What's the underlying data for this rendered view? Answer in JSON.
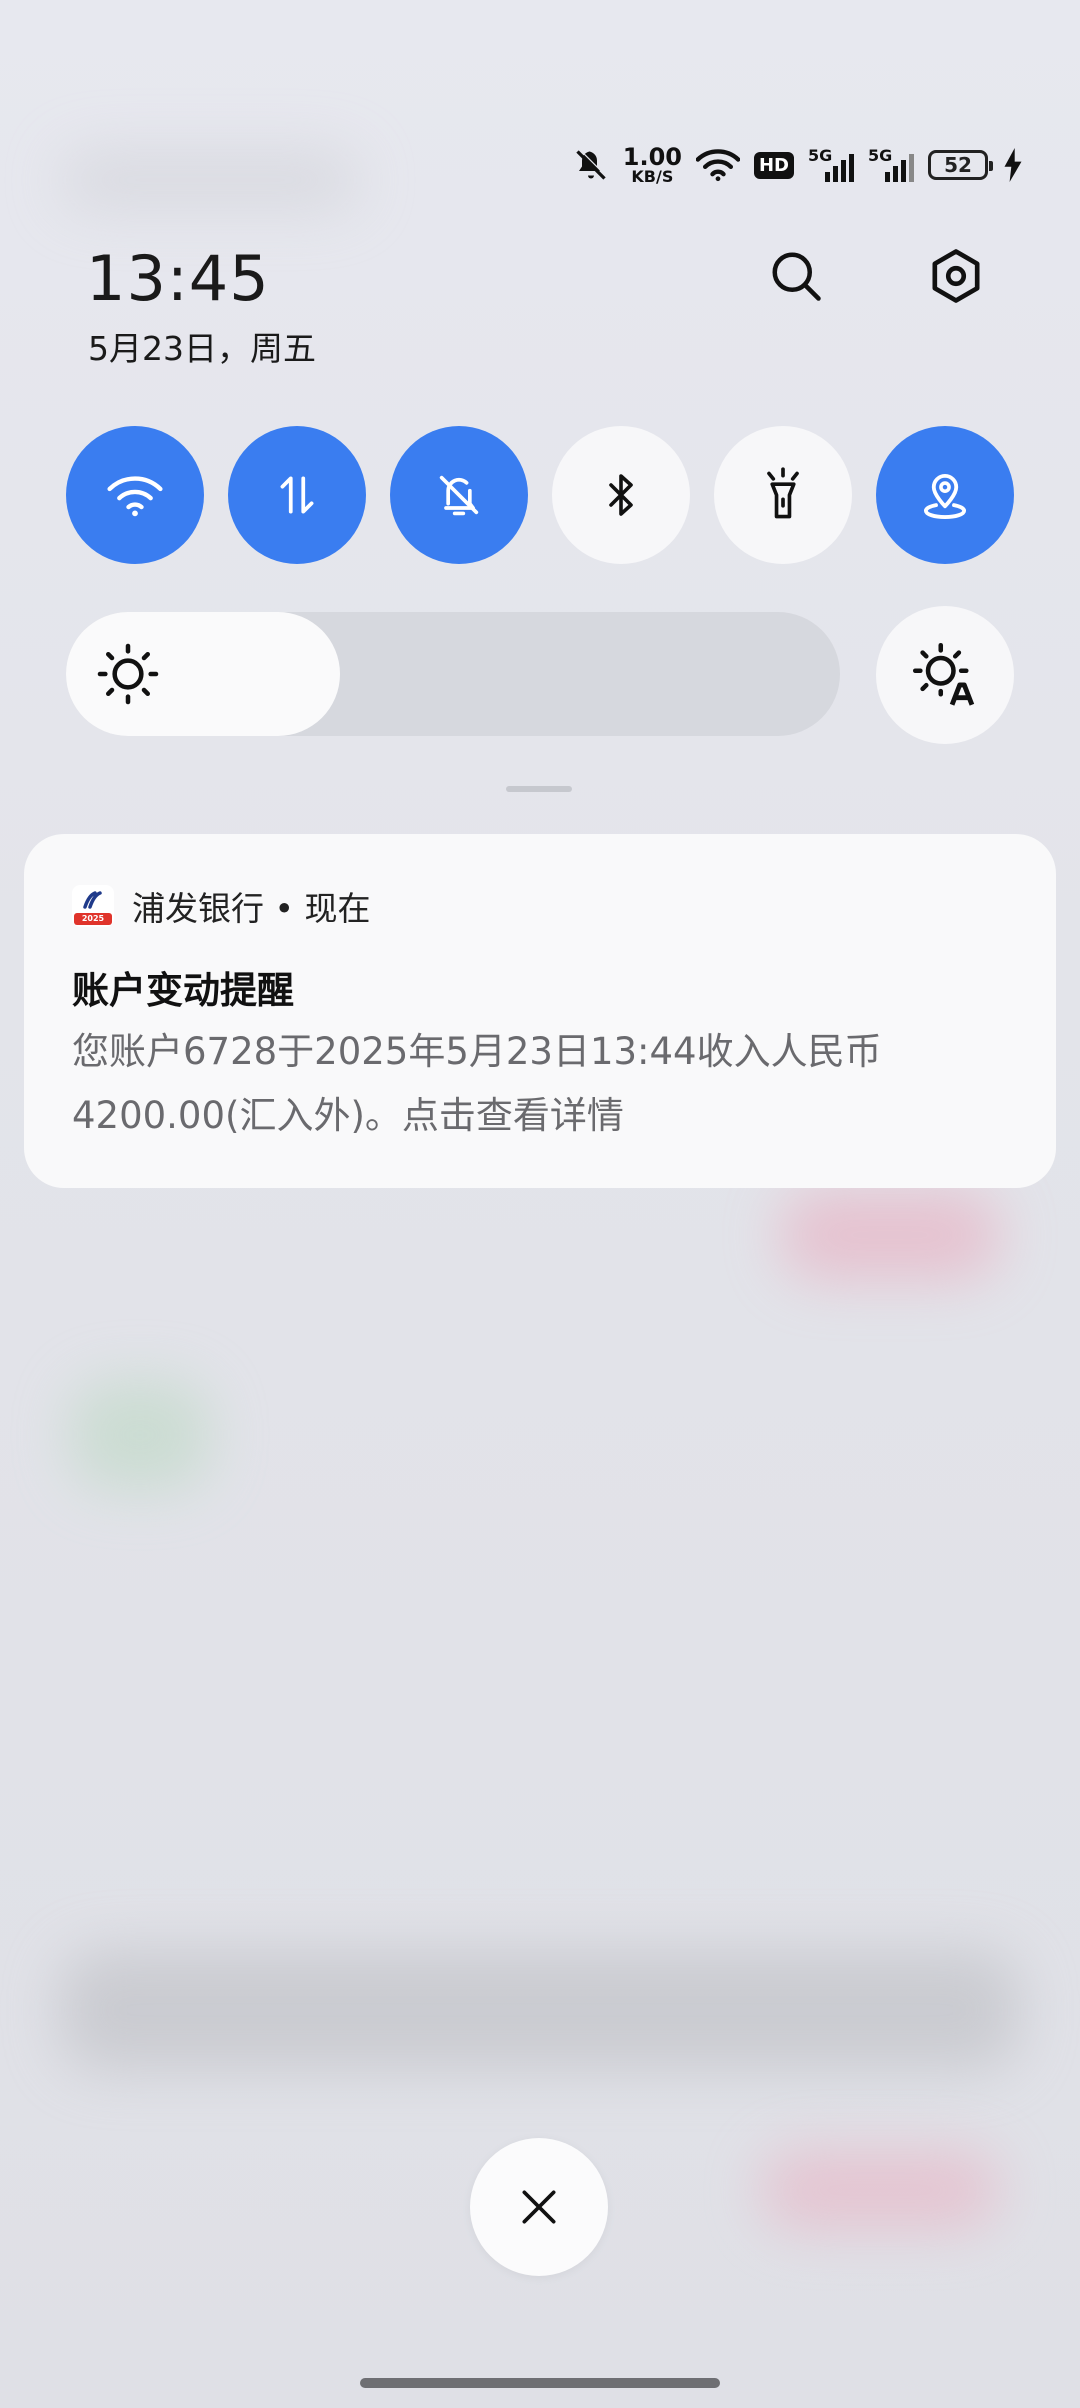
{
  "status_bar": {
    "net_speed_value": "1.00",
    "net_speed_unit": "KB/S",
    "hd_badge": "HD",
    "sim1_network": "5G",
    "sim2_network": "5G",
    "battery_level": "52",
    "icons": [
      "bell-off-icon",
      "wifi-icon",
      "hd-icon",
      "signal-icon",
      "signal-icon",
      "battery-icon",
      "charging-icon"
    ]
  },
  "header": {
    "time": "13:45",
    "date": "5月23日，周五",
    "search_icon": "search-icon",
    "settings_icon": "settings-icon"
  },
  "quick_tiles": [
    {
      "name": "wifi",
      "icon": "wifi-icon",
      "state": "on"
    },
    {
      "name": "mobile-data",
      "icon": "mobile-data-icon",
      "state": "on"
    },
    {
      "name": "silent",
      "icon": "bell-off-icon",
      "state": "on"
    },
    {
      "name": "bluetooth",
      "icon": "bluetooth-icon",
      "state": "off"
    },
    {
      "name": "flashlight",
      "icon": "flashlight-icon",
      "state": "off"
    },
    {
      "name": "location",
      "icon": "location-icon",
      "state": "on"
    }
  ],
  "brightness": {
    "level": 0.23,
    "icon": "sun-icon",
    "auto_icon": "auto-brightness-icon"
  },
  "notification": {
    "app_name": "浦发银行 • 现在",
    "app_icon_badge": "2025",
    "title": "账户变动提醒",
    "body": "您账户6728于2025年5月23日13:44收入人民币4200.00(汇入外)。点击查看详情"
  },
  "colors": {
    "accent": "#3a7df0",
    "tile_off": "#f7f7f9",
    "background": "#e6e7ed"
  }
}
